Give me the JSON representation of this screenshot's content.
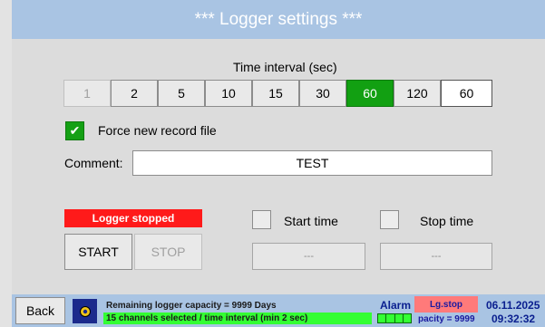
{
  "title": "*** Logger settings ***",
  "interval": {
    "label": "Time interval (sec)",
    "options": [
      "1",
      "2",
      "5",
      "10",
      "15",
      "30",
      "60",
      "120"
    ],
    "selected": "60",
    "custom_value": "60"
  },
  "force_new": {
    "label": "Force new record file",
    "checked": true
  },
  "comment": {
    "label": "Comment:",
    "value": "TEST"
  },
  "logger": {
    "status": "Logger stopped",
    "start_label": "START",
    "stop_label": "STOP"
  },
  "start_time": {
    "label": "Start time",
    "value": "---"
  },
  "stop_time": {
    "label": "Stop time",
    "value": "---"
  },
  "footer": {
    "back_label": "Back",
    "capacity_text": "Remaining logger capacity = 9999 Days",
    "channels_text": "15 channels selected / time interval (min 2 sec)",
    "alarm_label": "Alarm",
    "lg_stop_label": "Lg.stop",
    "capacity_short": "pacity = 9999",
    "date": "06.11.2025",
    "time": "09:32:32"
  },
  "colors": {
    "title_bg": "#a9c4e3",
    "selected_green": "#12a012",
    "status_red": "#ff1a1a",
    "status_green": "#33ff33"
  }
}
